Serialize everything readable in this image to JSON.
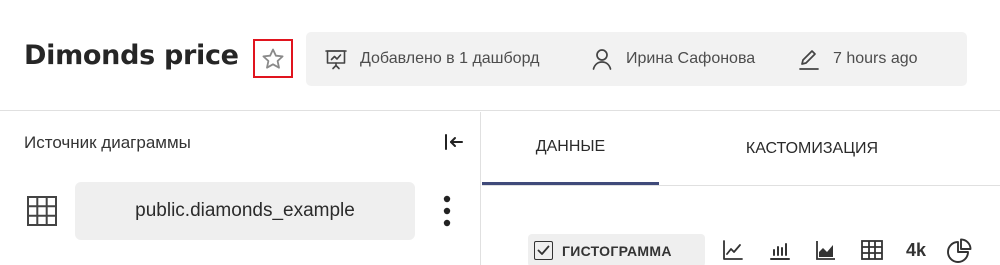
{
  "header": {
    "title": "Dimonds price",
    "favorite_icon": "star-outline-icon",
    "meta": {
      "dashboards": "Добавлено в 1 дашборд",
      "author": "Ирина Сафонова",
      "edited": "7 hours ago"
    }
  },
  "source": {
    "title": "Источник диаграммы",
    "name": "public.diamonds_example",
    "collapse_icon": "collapse-left-icon",
    "table_icon": "table-grid-icon",
    "menu_icon": "kebab-menu-icon"
  },
  "tabs": [
    {
      "label": "ДАННЫЕ",
      "active": true
    },
    {
      "label": "КАСТОМИЗАЦИЯ",
      "active": false
    }
  ],
  "chart_types": {
    "selected": "ГИСТОГРАММА",
    "numeric_label": "4k",
    "options": [
      "histogram",
      "line-chart",
      "bar-chart",
      "area-chart",
      "table",
      "big-number",
      "pie-chart"
    ]
  },
  "colors": {
    "favorite_highlight": "#e0141e",
    "active_tab_underline": "#3f4a7a",
    "meta_background": "#f2f2f2"
  }
}
